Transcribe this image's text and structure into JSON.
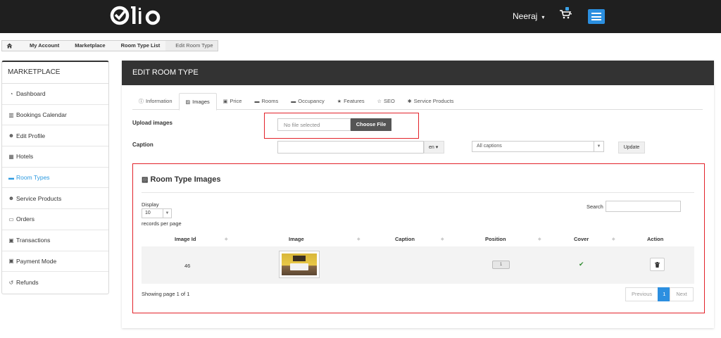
{
  "header": {
    "brand": "Qlo",
    "user_name": "Neeraj",
    "user_caret": "▾",
    "cart_icon": "cart-icon",
    "menu_icon": "hamburger-icon",
    "colors": {
      "bar": "#1f1f1f",
      "accent": "#2b8fe0"
    }
  },
  "breadcrumb": {
    "items": [
      "My Account",
      "Marketplace",
      "Room Type List",
      "Edit Room Type"
    ],
    "home_icon": "home-icon"
  },
  "sidebar": {
    "title": "MARKETPLACE",
    "items": [
      {
        "label": "Dashboard",
        "icon": "dashboard-icon",
        "glyph": "◔"
      },
      {
        "label": "Bookings Calendar",
        "icon": "chart-icon",
        "glyph": "▥"
      },
      {
        "label": "Edit Profile",
        "icon": "user-icon",
        "glyph": "☻"
      },
      {
        "label": "Hotels",
        "icon": "building-icon",
        "glyph": "▦"
      },
      {
        "label": "Room Types",
        "icon": "bed-icon",
        "glyph": "▬"
      },
      {
        "label": "Service Products",
        "icon": "users-icon",
        "glyph": "☻"
      },
      {
        "label": "Orders",
        "icon": "card-icon",
        "glyph": "▭"
      },
      {
        "label": "Transactions",
        "icon": "money-icon",
        "glyph": "▣"
      },
      {
        "label": "Payment Mode",
        "icon": "money-icon",
        "glyph": "▣"
      },
      {
        "label": "Refunds",
        "icon": "undo-icon",
        "glyph": "↺"
      }
    ],
    "active_color": "#2c9ae0"
  },
  "panel": {
    "title": "EDIT ROOM TYPE",
    "tabs": [
      {
        "label": "Information",
        "glyph": "ⓘ",
        "icon": "info-icon"
      },
      {
        "label": "Images",
        "glyph": "▨",
        "icon": "image-icon"
      },
      {
        "label": "Price",
        "glyph": "▣",
        "icon": "money-icon"
      },
      {
        "label": "Rooms",
        "glyph": "▬",
        "icon": "bed-icon"
      },
      {
        "label": "Occupancy",
        "glyph": "▬",
        "icon": "bed-icon"
      },
      {
        "label": "Features",
        "glyph": "★",
        "icon": "star-icon"
      },
      {
        "label": "SEO",
        "glyph": "☆",
        "icon": "star-outline-icon"
      },
      {
        "label": "Service Products",
        "glyph": "✱",
        "icon": "gear-icon"
      }
    ],
    "active_tab": "Images"
  },
  "upload": {
    "label": "Upload images",
    "file_status": "No file selected",
    "choose_button": "Choose File"
  },
  "caption": {
    "label": "Caption",
    "value": "",
    "language": "en ▾",
    "filter_selected": "All captions",
    "update_button": "Update"
  },
  "images_section": {
    "title": "Room Type Images",
    "title_icon": "image-icon",
    "display_label": "Display",
    "display_value": "10",
    "records_per_page": "records per page",
    "search_label": "Search",
    "search_value": "",
    "columns": [
      "Image Id",
      "Image",
      "Caption",
      "Position",
      "Cover",
      "Action"
    ],
    "rows": [
      {
        "image_id": "46",
        "caption": "",
        "position": "1",
        "cover": "✔",
        "action_icon": "trash-icon"
      }
    ],
    "showing": "Showing page 1 of 1",
    "pagination": {
      "previous": "Previous",
      "current": "1",
      "next": "Next"
    }
  },
  "highlight_color": "#e3222a"
}
